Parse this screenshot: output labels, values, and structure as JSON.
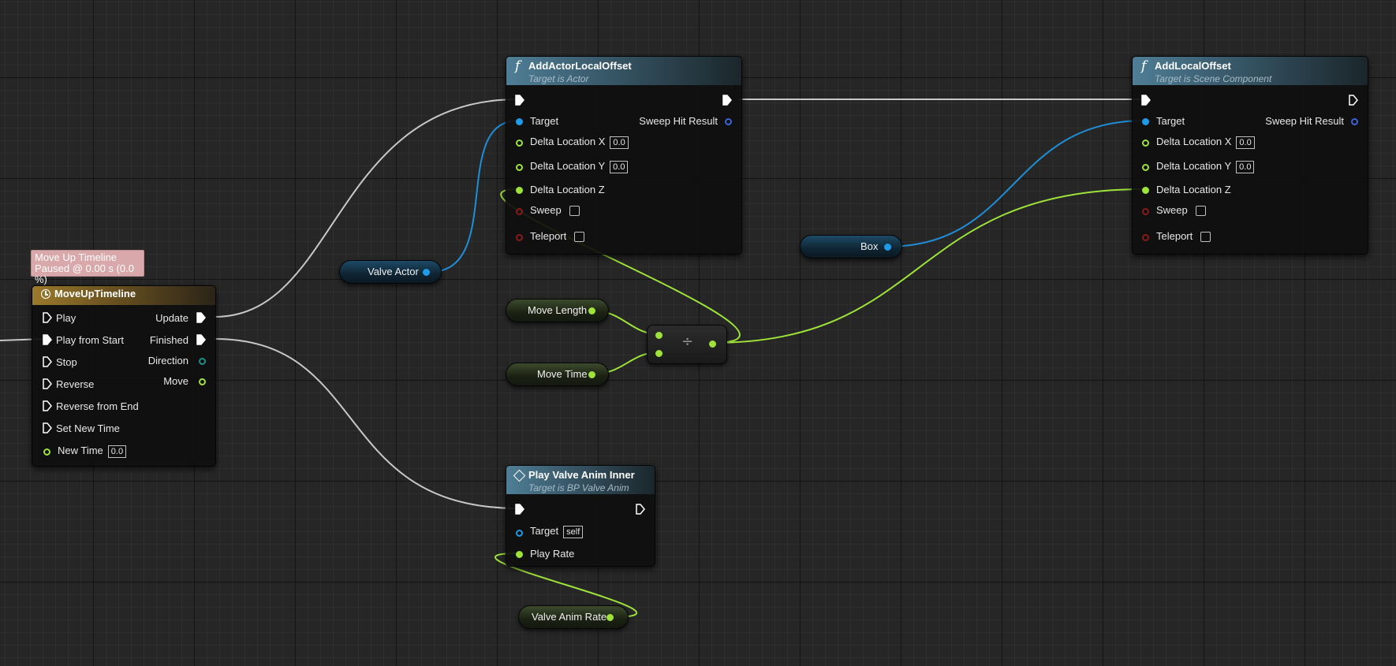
{
  "comment": {
    "line1": "Move Up Timeline",
    "line2": "Paused @ 0.00 s (0.0 %)"
  },
  "timeline": {
    "title": "MoveUpTimeline",
    "inputs": [
      "Play",
      "Play from Start",
      "Stop",
      "Reverse",
      "Reverse from End",
      "Set New Time"
    ],
    "new_time_label": "New Time",
    "new_time_value": "0.0",
    "outputs": {
      "update": "Update",
      "finished": "Finished",
      "direction": "Direction",
      "move": "Move"
    }
  },
  "add_actor_offset": {
    "title": "AddActorLocalOffset",
    "subtitle": "Target is Actor",
    "target": "Target",
    "sweep_hit": "Sweep Hit Result",
    "dx_label": "Delta Location X",
    "dx_value": "0.0",
    "dy_label": "Delta Location Y",
    "dy_value": "0.0",
    "dz_label": "Delta Location Z",
    "sweep": "Sweep",
    "teleport": "Teleport"
  },
  "add_local_offset": {
    "title": "AddLocalOffset",
    "subtitle": "Target is Scene Component",
    "target": "Target",
    "sweep_hit": "Sweep Hit Result",
    "dx_label": "Delta Location X",
    "dx_value": "0.0",
    "dy_label": "Delta Location Y",
    "dy_value": "0.0",
    "dz_label": "Delta Location Z",
    "sweep": "Sweep",
    "teleport": "Teleport"
  },
  "play_valve": {
    "title": "Play Valve Anim Inner",
    "subtitle": "Target is BP Valve Anim",
    "target": "Target",
    "target_value": "self",
    "play_rate": "Play Rate"
  },
  "variables": {
    "valve_actor": "Valve Actor",
    "box": "Box",
    "move_length": "Move Length",
    "move_time": "Move Time",
    "valve_anim_rate": "Valve Anim Rate"
  },
  "divide_symbol": "÷",
  "colors": {
    "exec_wire": "#c8c8c8",
    "object_pin": "#1f9bea",
    "float_pin": "#9ee23a",
    "bool_pin": "#8a1a1a",
    "function_header": "#4f7e96",
    "timeline_header": "#9a7a2c",
    "comment_bg": "#d8a8aa"
  }
}
